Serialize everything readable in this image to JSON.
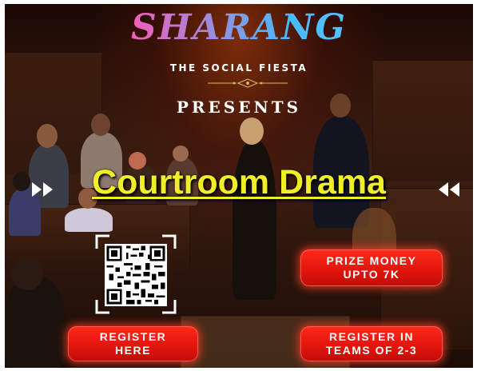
{
  "logo": {
    "text": "SHARANG"
  },
  "tagline": "THE SOCIAL FIESTA",
  "presents": "PRESENTS",
  "event_title": "Courtroom Drama",
  "prize": {
    "line1": "PRIZE MONEY",
    "line2": "UPTO 7K"
  },
  "register": {
    "line1": "REGISTER",
    "line2": "HERE"
  },
  "teams": {
    "line1": "REGISTER IN",
    "line2": "TEAMS OF 2-3"
  },
  "colors": {
    "title": "#f0ee27",
    "button": "#e3150d",
    "logo_pink": "#ff2d8a",
    "logo_blue": "#3fb5ff"
  },
  "icons": {
    "left_arrow": "double-chevron-right-icon",
    "right_arrow": "double-chevron-left-icon",
    "qr": "qr-code-icon"
  }
}
